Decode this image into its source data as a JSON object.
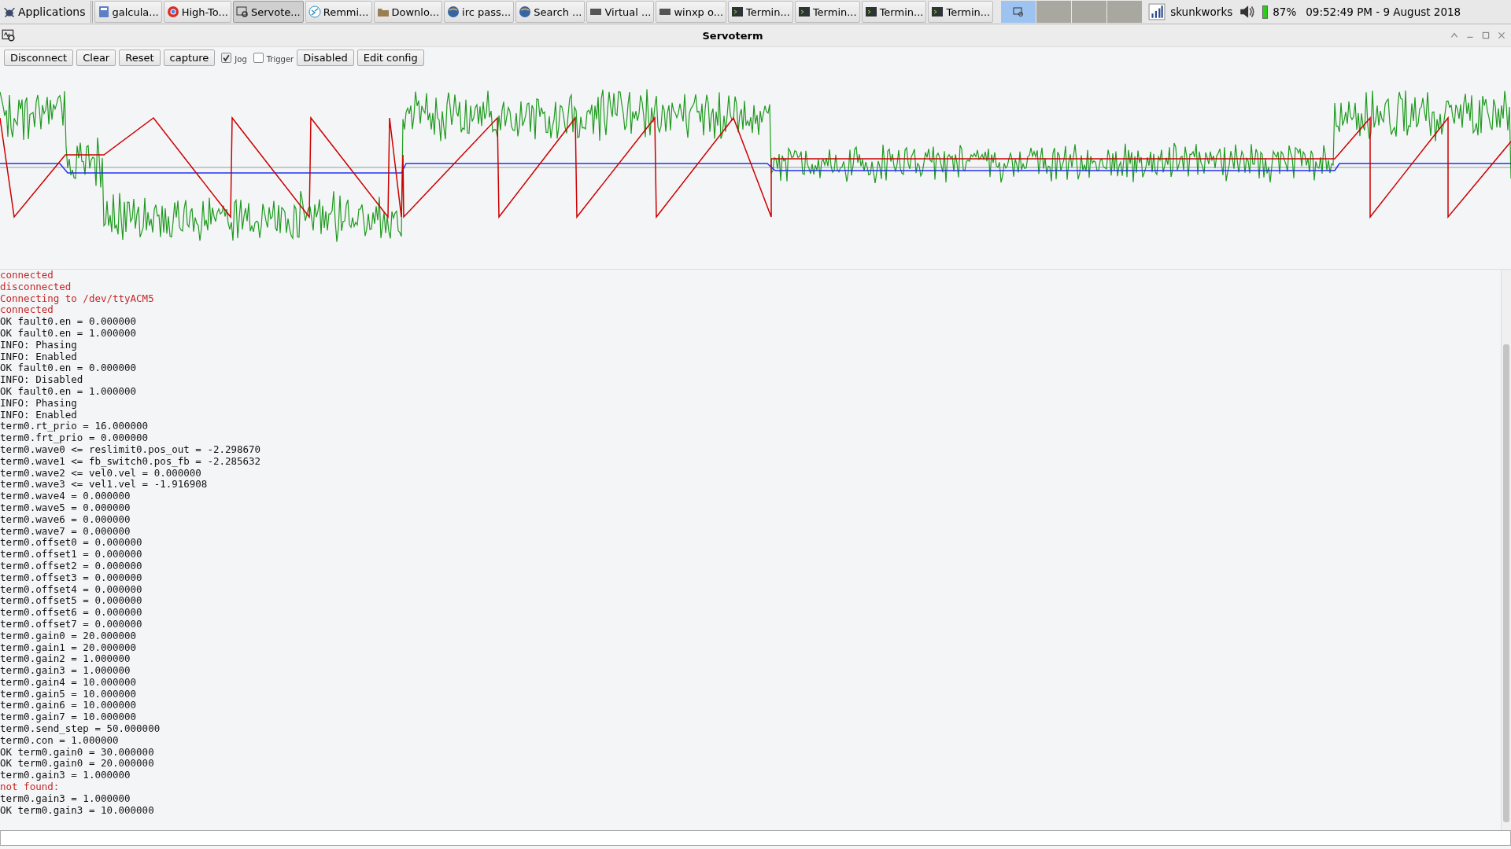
{
  "taskbar": {
    "menu_label": "Applications",
    "tasks": [
      {
        "label": "galcula...",
        "kind": "calculator",
        "selected": false
      },
      {
        "label": "High-To...",
        "kind": "browser",
        "selected": false
      },
      {
        "label": "Servote...",
        "kind": "scope",
        "selected": true
      },
      {
        "label": "Remmi...",
        "kind": "remote",
        "selected": false
      },
      {
        "label": "Downlo...",
        "kind": "folder",
        "selected": false
      },
      {
        "label": "irc pass...",
        "kind": "globe",
        "selected": false
      },
      {
        "label": "Search ...",
        "kind": "globe",
        "selected": false
      },
      {
        "label": "Virtual ...",
        "kind": "vm",
        "selected": false
      },
      {
        "label": "winxp o...",
        "kind": "vm",
        "selected": false
      },
      {
        "label": "Termin...",
        "kind": "terminal",
        "selected": false
      },
      {
        "label": "Termin...",
        "kind": "terminal",
        "selected": false
      },
      {
        "label": "Termin...",
        "kind": "terminal",
        "selected": false
      },
      {
        "label": "Termin...",
        "kind": "terminal",
        "selected": false
      }
    ],
    "workspaces": [
      {
        "selected": true
      },
      {
        "selected": false
      },
      {
        "selected": false
      },
      {
        "selected": false
      }
    ],
    "hostname": "skunkworks",
    "battery": "87%",
    "clock": "09:52:49 PM - 9 August 2018"
  },
  "window": {
    "title": "Servoterm"
  },
  "toolbar": [
    {
      "kind": "button",
      "label": "Disconnect"
    },
    {
      "kind": "button",
      "label": "Clear"
    },
    {
      "kind": "button",
      "label": "Reset"
    },
    {
      "kind": "button",
      "label": "capture"
    },
    {
      "kind": "checkbox",
      "label": "Jog",
      "checked": true
    },
    {
      "kind": "checkbox",
      "label": "Trigger",
      "checked": false
    },
    {
      "kind": "button",
      "label": "Disabled"
    },
    {
      "kind": "button",
      "label": "Edit config"
    }
  ],
  "log": [
    {
      "kind": "error",
      "text": "connected"
    },
    {
      "kind": "error",
      "text": "disconnected"
    },
    {
      "kind": "error",
      "text": "Connecting to /dev/ttyACM5"
    },
    {
      "kind": "error",
      "text": "connected"
    },
    {
      "kind": "normal",
      "text": "OK fault0.en = 0.000000"
    },
    {
      "kind": "normal",
      "text": "OK fault0.en = 1.000000"
    },
    {
      "kind": "normal",
      "text": "INFO: Phasing"
    },
    {
      "kind": "normal",
      "text": "INFO: Enabled"
    },
    {
      "kind": "normal",
      "text": "OK fault0.en = 0.000000"
    },
    {
      "kind": "normal",
      "text": "INFO: Disabled"
    },
    {
      "kind": "normal",
      "text": "OK fault0.en = 1.000000"
    },
    {
      "kind": "normal",
      "text": "INFO: Phasing"
    },
    {
      "kind": "normal",
      "text": "INFO: Enabled"
    },
    {
      "kind": "normal",
      "text": "term0.rt_prio = 16.000000"
    },
    {
      "kind": "normal",
      "text": "term0.frt_prio = 0.000000"
    },
    {
      "kind": "normal",
      "text": "term0.wave0 <= reslimit0.pos_out = -2.298670"
    },
    {
      "kind": "normal",
      "text": "term0.wave1 <= fb_switch0.pos_fb = -2.285632"
    },
    {
      "kind": "normal",
      "text": "term0.wave2 <= vel0.vel = 0.000000"
    },
    {
      "kind": "normal",
      "text": "term0.wave3 <= vel1.vel = -1.916908"
    },
    {
      "kind": "normal",
      "text": "term0.wave4 = 0.000000"
    },
    {
      "kind": "normal",
      "text": "term0.wave5 = 0.000000"
    },
    {
      "kind": "normal",
      "text": "term0.wave6 = 0.000000"
    },
    {
      "kind": "normal",
      "text": "term0.wave7 = 0.000000"
    },
    {
      "kind": "normal",
      "text": "term0.offset0 = 0.000000"
    },
    {
      "kind": "normal",
      "text": "term0.offset1 = 0.000000"
    },
    {
      "kind": "normal",
      "text": "term0.offset2 = 0.000000"
    },
    {
      "kind": "normal",
      "text": "term0.offset3 = 0.000000"
    },
    {
      "kind": "normal",
      "text": "term0.offset4 = 0.000000"
    },
    {
      "kind": "normal",
      "text": "term0.offset5 = 0.000000"
    },
    {
      "kind": "normal",
      "text": "term0.offset6 = 0.000000"
    },
    {
      "kind": "normal",
      "text": "term0.offset7 = 0.000000"
    },
    {
      "kind": "normal",
      "text": "term0.gain0 = 20.000000"
    },
    {
      "kind": "normal",
      "text": "term0.gain1 = 20.000000"
    },
    {
      "kind": "normal",
      "text": "term0.gain2 = 1.000000"
    },
    {
      "kind": "normal",
      "text": "term0.gain3 = 1.000000"
    },
    {
      "kind": "normal",
      "text": "term0.gain4 = 10.000000"
    },
    {
      "kind": "normal",
      "text": "term0.gain5 = 10.000000"
    },
    {
      "kind": "normal",
      "text": "term0.gain6 = 10.000000"
    },
    {
      "kind": "normal",
      "text": "term0.gain7 = 10.000000"
    },
    {
      "kind": "normal",
      "text": "term0.send_step = 50.000000"
    },
    {
      "kind": "normal",
      "text": "term0.con = 1.000000"
    },
    {
      "kind": "normal",
      "text": "OK term0.gain0 = 30.000000"
    },
    {
      "kind": "normal",
      "text": "OK term0.gain0 = 20.000000"
    },
    {
      "kind": "normal",
      "text": "term0.gain3 = 1.000000"
    },
    {
      "kind": "error",
      "text": "not found:"
    },
    {
      "kind": "normal",
      "text": "term0.gain3 = 1.000000"
    },
    {
      "kind": "normal",
      "text": "OK term0.gain3 = 10.000000"
    }
  ]
}
